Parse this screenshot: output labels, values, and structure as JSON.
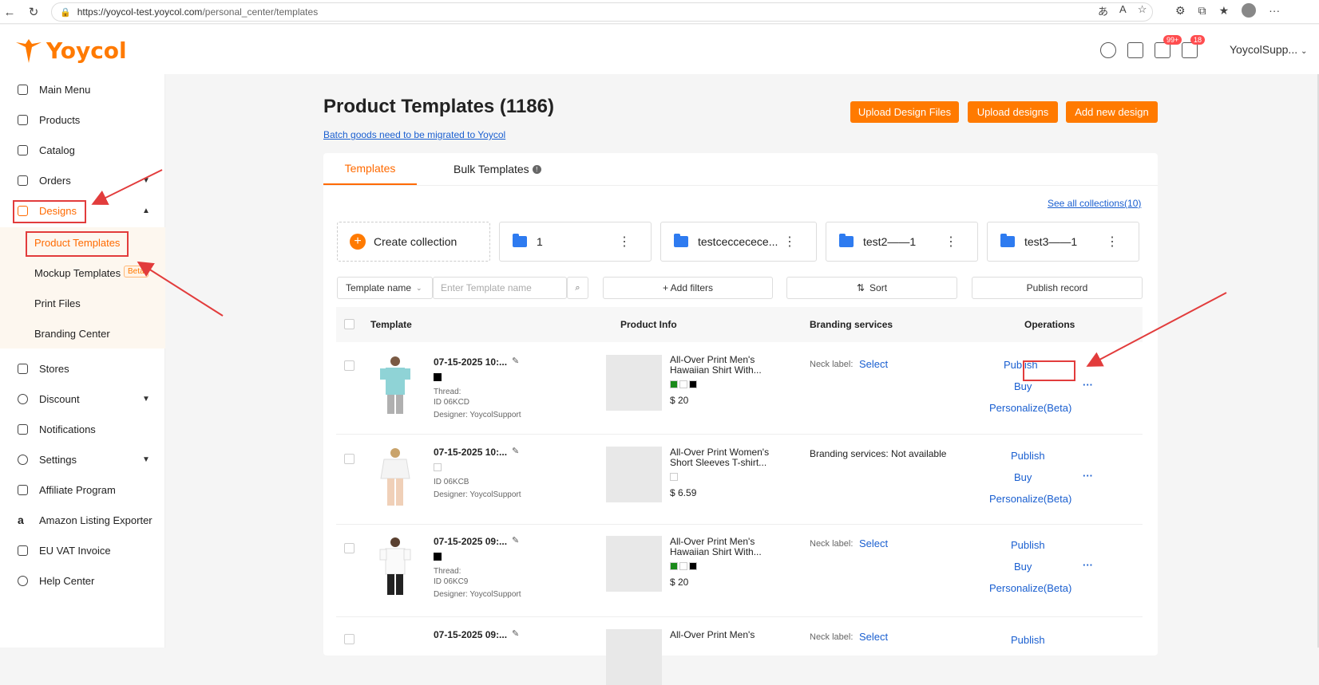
{
  "browser": {
    "url": "https://yoycol-test.yoycol.com/personal_center/templates",
    "url_host": "https://yoycol-test.yoycol.com",
    "url_path": "/personal_center/templates"
  },
  "topnav": {
    "logo_text": "Yoycol",
    "messages_badge": "99+",
    "cart_badge": "18",
    "user_name": "YoycolSupp..."
  },
  "sidebar": {
    "items": [
      {
        "label": "Main Menu"
      },
      {
        "label": "Products"
      },
      {
        "label": "Catalog"
      },
      {
        "label": "Orders"
      },
      {
        "label": "Designs"
      },
      {
        "label": "Stores"
      },
      {
        "label": "Discount"
      },
      {
        "label": "Notifications"
      },
      {
        "label": "Settings"
      },
      {
        "label": "Affiliate Program"
      },
      {
        "label": "Amazon Listing Exporter"
      },
      {
        "label": "EU VAT Invoice"
      },
      {
        "label": "Help Center"
      }
    ],
    "design_sub": [
      {
        "label": "Product Templates"
      },
      {
        "label": "Mockup Templates",
        "badge": "Beta"
      },
      {
        "label": "Print Files"
      },
      {
        "label": "Branding Center"
      }
    ]
  },
  "main": {
    "title": "Product Templates (1186)",
    "batch_link": "Batch goods need to be migrated to Yoycol",
    "buttons": {
      "upload_design_files": "Upload Design Files",
      "upload_designs": "Upload designs",
      "add_new_design": "Add new design"
    },
    "tabs": [
      {
        "label": "Templates",
        "active": true
      },
      {
        "label": "Bulk Templates",
        "active": false
      }
    ],
    "see_all": "See all collections(10)",
    "collections": {
      "create": "Create collection",
      "items": [
        "1",
        "testceccecece...",
        "test2——1",
        "test3——1"
      ]
    },
    "filters": {
      "field_select": "Template name",
      "search_placeholder": "Enter Template name",
      "add_filters": "+ Add filters",
      "sort": "Sort",
      "publish_record": "Publish record"
    },
    "table": {
      "headers": [
        "Template",
        "Product Info",
        "Branding services",
        "Operations"
      ],
      "rows": [
        {
          "date": "07-15-2025 10:...",
          "thread": "Thread:",
          "id": "ID 06KCD",
          "designer": "Designer: YoycolSupport",
          "product_line1": "All-Over Print Men's",
          "product_line2": "Hawaiian Shirt With...",
          "price": "$ 20",
          "branding_label": "Neck label:",
          "branding_link": "Select",
          "publish": "Publish",
          "buy": "Buy",
          "personalize": "Personalize(Beta)"
        },
        {
          "date": "07-15-2025 10:...",
          "thread": "",
          "id": "ID 06KCB",
          "designer": "Designer: YoycolSupport",
          "product_line1": "All-Over Print Women's",
          "product_line2": "Short Sleeves T-shirt...",
          "price": "$ 6.59",
          "branding_text": "Branding services: Not available",
          "publish": "Publish",
          "buy": "Buy",
          "personalize": "Personalize(Beta)"
        },
        {
          "date": "07-15-2025 09:...",
          "thread": "Thread:",
          "id": "ID 06KC9",
          "designer": "Designer: YoycolSupport",
          "product_line1": "All-Over Print Men's",
          "product_line2": "Hawaiian Shirt With...",
          "price": "$ 20",
          "branding_label": "Neck label:",
          "branding_link": "Select",
          "publish": "Publish",
          "buy": "Buy",
          "personalize": "Personalize(Beta)"
        },
        {
          "date": "07-15-2025 09:...",
          "product_line1": "All-Over Print Men's",
          "branding_label": "Neck label:",
          "branding_link": "Select",
          "publish": "Publish"
        }
      ]
    }
  },
  "colors": {
    "accent": "#ff7a00",
    "link": "#1a5fd0",
    "annotation": "#e23c3c"
  }
}
